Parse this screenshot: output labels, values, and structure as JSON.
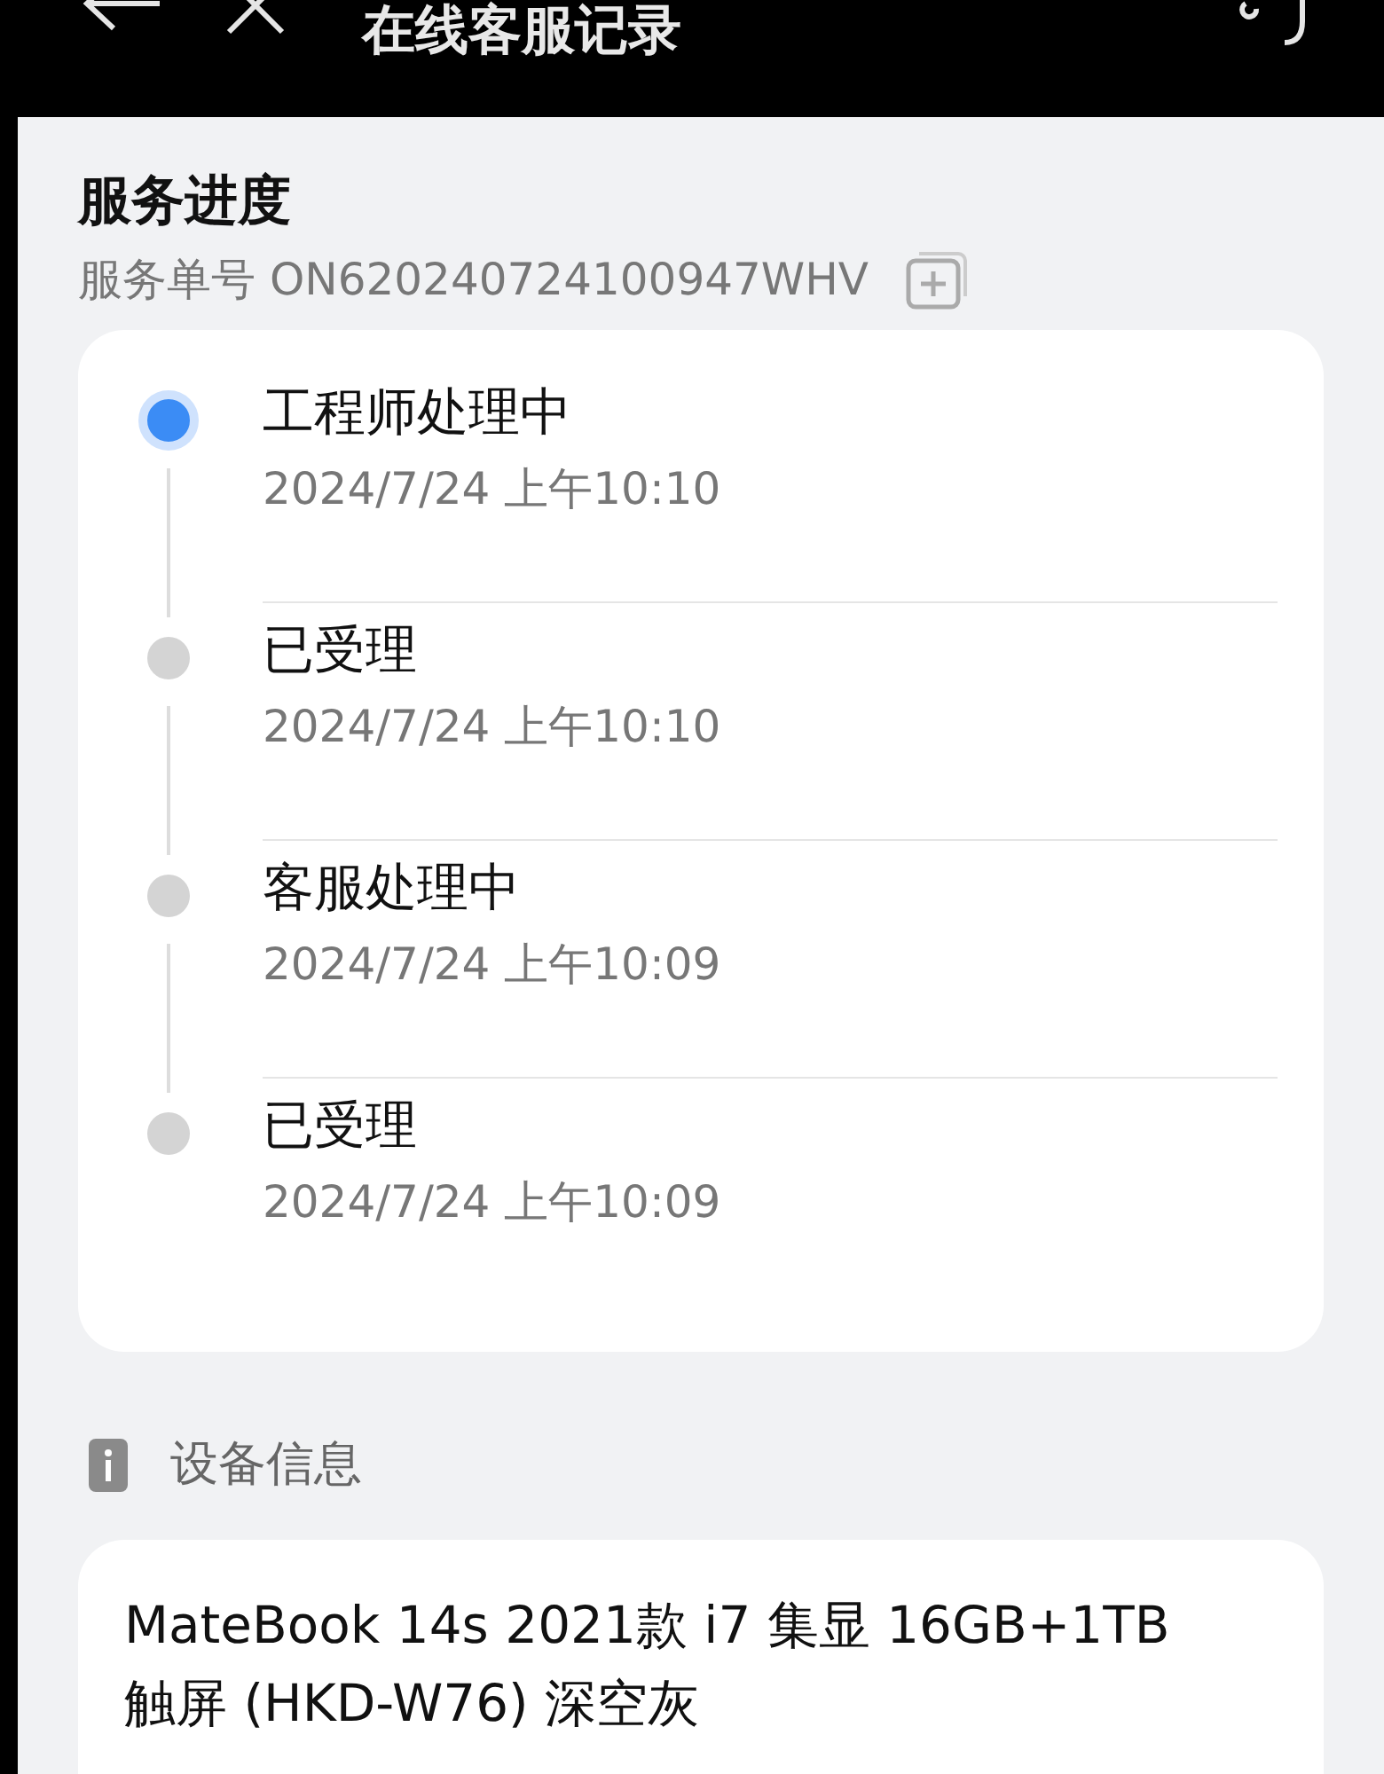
{
  "header": {
    "title": "在线客服记录"
  },
  "progress": {
    "title": "服务进度",
    "order_label": "服务单号",
    "order_number": "ON620240724100947WHV",
    "steps": [
      {
        "status": "工程师处理中",
        "time": "2024/7/24 上午10:10",
        "current": true
      },
      {
        "status": "已受理",
        "time": "2024/7/24 上午10:10",
        "current": false
      },
      {
        "status": "客服处理中",
        "time": "2024/7/24 上午10:09",
        "current": false
      },
      {
        "status": "已受理",
        "time": "2024/7/24 上午10:09",
        "current": false
      }
    ]
  },
  "device": {
    "title": "设备信息",
    "name": "MateBook 14s 2021款 i7 集显 16GB+1TB 触屏 (HKD-W76) 深空灰"
  }
}
